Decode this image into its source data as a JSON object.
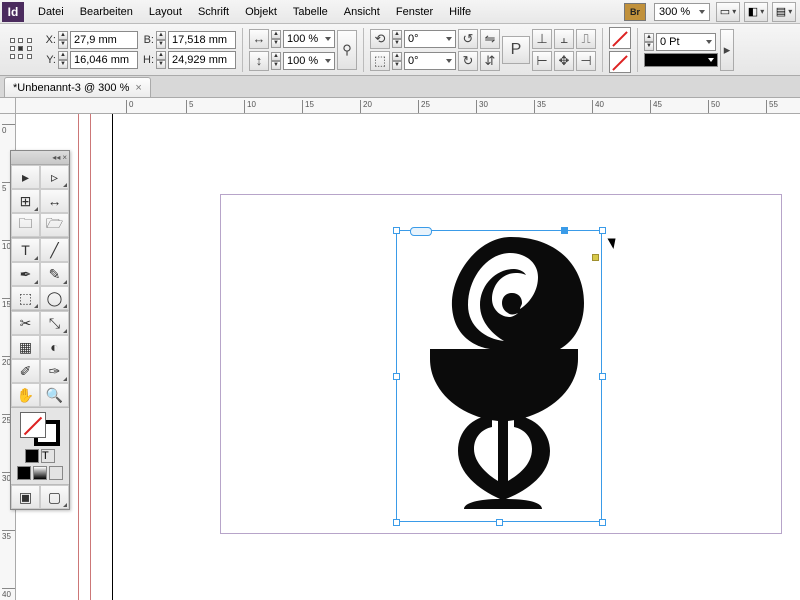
{
  "logo": "Id",
  "menu": [
    "Datei",
    "Bearbeiten",
    "Layout",
    "Schrift",
    "Objekt",
    "Tabelle",
    "Ansicht",
    "Fenster",
    "Hilfe"
  ],
  "bridge_label": "Br",
  "top_zoom": "300 %",
  "control": {
    "x": "27,9 mm",
    "y": "16,046 mm",
    "w": "17,518 mm",
    "h": "24,929 mm",
    "labels": {
      "x": "X:",
      "y": "Y:",
      "w": "B:",
      "h": "H:"
    },
    "scale_x": "100 %",
    "scale_y": "100 %",
    "rotate": "0°",
    "shear": "0°",
    "stroke_weight": "0 Pt"
  },
  "doc_tab": {
    "title": "*Unbenannt-3 @ 300 %",
    "close": "×"
  },
  "ruler_h": [
    "0",
    "5",
    "10",
    "15",
    "20",
    "25",
    "30",
    "35",
    "40",
    "45",
    "50",
    "55"
  ],
  "ruler_v": [
    "0",
    "5",
    "10",
    "15",
    "20",
    "25",
    "30",
    "35",
    "40"
  ]
}
